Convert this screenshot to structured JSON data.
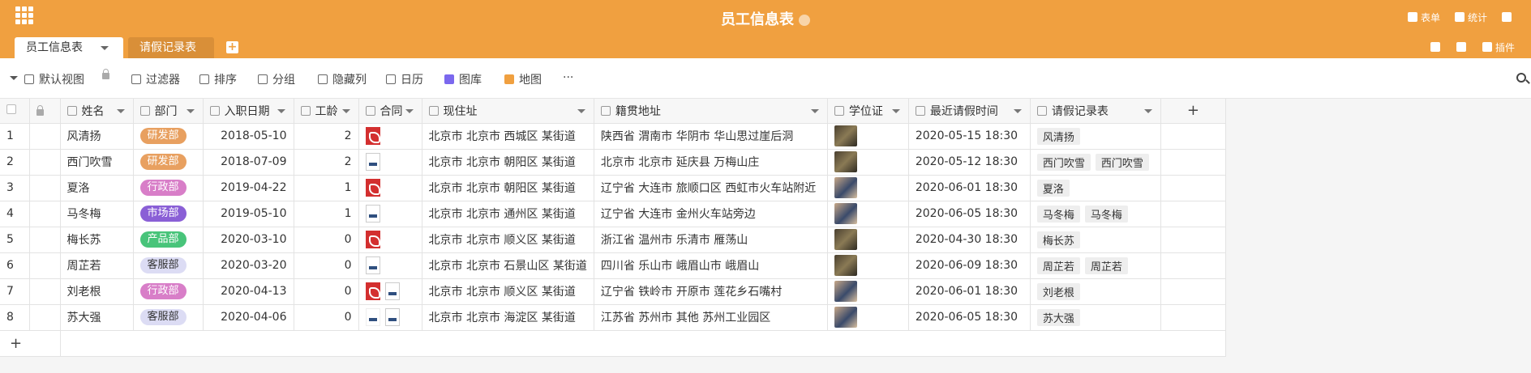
{
  "app": {
    "title": "员工信息表",
    "top_actions": [
      {
        "icon": "form-icon",
        "label": "表单"
      },
      {
        "icon": "stats-icon",
        "label": "统计"
      },
      {
        "icon": "bell-icon",
        "label": ""
      }
    ]
  },
  "tabs": {
    "active": "员工信息表",
    "inactive": "请假记录表",
    "plugin_label": "插件"
  },
  "toolbar": {
    "view": "默认视图",
    "filter": "过滤器",
    "sort": "排序",
    "group": "分组",
    "hide": "隐藏列",
    "calendar": "日历",
    "gallery": "图库",
    "map": "地图",
    "more": "···"
  },
  "columns": {
    "name": "姓名",
    "dept": "部门",
    "join": "入职日期",
    "years": "工龄",
    "contract": "合同",
    "address": "现住址",
    "origin": "籍贯地址",
    "degree": "学位证",
    "leave_time": "最近请假时间",
    "leave_records": "请假记录表",
    "add": "+"
  },
  "colors": {
    "研发部": "#e8a060",
    "行政部": "#d87ec8",
    "市场部": "#8a5fd6",
    "产品部": "#48c47a",
    "客服部": "#dcdcf4",
    "accent": "#f0a040"
  },
  "rows": [
    {
      "no": "1",
      "name": "风清扬",
      "dept": "研发部",
      "join": "2018-05-10",
      "years": "2",
      "contract": [
        "pdf"
      ],
      "address": "北京市 北京市 西城区 某街道",
      "origin": "陕西省 渭南市 华阴市 华山思过崖后洞",
      "degree": "dark",
      "leave_time": "2020-05-15 18:30",
      "leave_records": [
        "风清扬"
      ]
    },
    {
      "no": "2",
      "name": "西门吹雪",
      "dept": "研发部",
      "join": "2018-07-09",
      "years": "2",
      "contract": [
        "doc"
      ],
      "address": "北京市 北京市 朝阳区 某街道",
      "origin": "北京市 北京市 延庆县 万梅山庄",
      "degree": "dark",
      "leave_time": "2020-05-12 18:30",
      "leave_records": [
        "西门吹雪",
        "西门吹雪"
      ]
    },
    {
      "no": "3",
      "name": "夏洛",
      "dept": "行政部",
      "join": "2019-04-22",
      "years": "1",
      "contract": [
        "pdf"
      ],
      "address": "北京市 北京市 朝阳区 某街道",
      "origin": "辽宁省 大连市 旅顺口区 西虹市火车站附近",
      "degree": "light",
      "leave_time": "2020-06-01 18:30",
      "leave_records": [
        "夏洛"
      ]
    },
    {
      "no": "4",
      "name": "马冬梅",
      "dept": "市场部",
      "join": "2019-05-10",
      "years": "1",
      "contract": [
        "doc"
      ],
      "address": "北京市 北京市 通州区 某街道",
      "origin": "辽宁省 大连市 金州火车站旁边",
      "degree": "light",
      "leave_time": "2020-06-05 18:30",
      "leave_records": [
        "马冬梅",
        "马冬梅"
      ]
    },
    {
      "no": "5",
      "name": "梅长苏",
      "dept": "产品部",
      "join": "2020-03-10",
      "years": "0",
      "contract": [
        "pdf"
      ],
      "address": "北京市 北京市 顺义区 某街道",
      "origin": "浙江省 温州市 乐清市 雁荡山",
      "degree": "dark",
      "leave_time": "2020-04-30 18:30",
      "leave_records": [
        "梅长苏"
      ]
    },
    {
      "no": "6",
      "name": "周芷若",
      "dept": "客服部",
      "join": "2020-03-20",
      "years": "0",
      "contract": [
        "doc"
      ],
      "address": "北京市 北京市 石景山区 某街道",
      "origin": "四川省 乐山市 峨眉山市 峨眉山",
      "degree": "dark",
      "leave_time": "2020-06-09 18:30",
      "leave_records": [
        "周芷若",
        "周芷若"
      ]
    },
    {
      "no": "7",
      "name": "刘老根",
      "dept": "行政部",
      "join": "2020-04-13",
      "years": "0",
      "contract": [
        "pdf",
        "doc"
      ],
      "address": "北京市 北京市 顺义区 某街道",
      "origin": "辽宁省 铁岭市 开原市 莲花乡石嘴村",
      "degree": "light",
      "leave_time": "2020-06-01 18:30",
      "leave_records": [
        "刘老根"
      ]
    },
    {
      "no": "8",
      "name": "苏大强",
      "dept": "客服部",
      "join": "2020-04-06",
      "years": "0",
      "contract": [
        "blank",
        "doc"
      ],
      "address": "北京市 北京市 海淀区 某街道",
      "origin": "江苏省 苏州市 其他 苏州工业园区",
      "degree": "light",
      "leave_time": "2020-06-05 18:30",
      "leave_records": [
        "苏大强"
      ]
    }
  ],
  "add_row": "+"
}
